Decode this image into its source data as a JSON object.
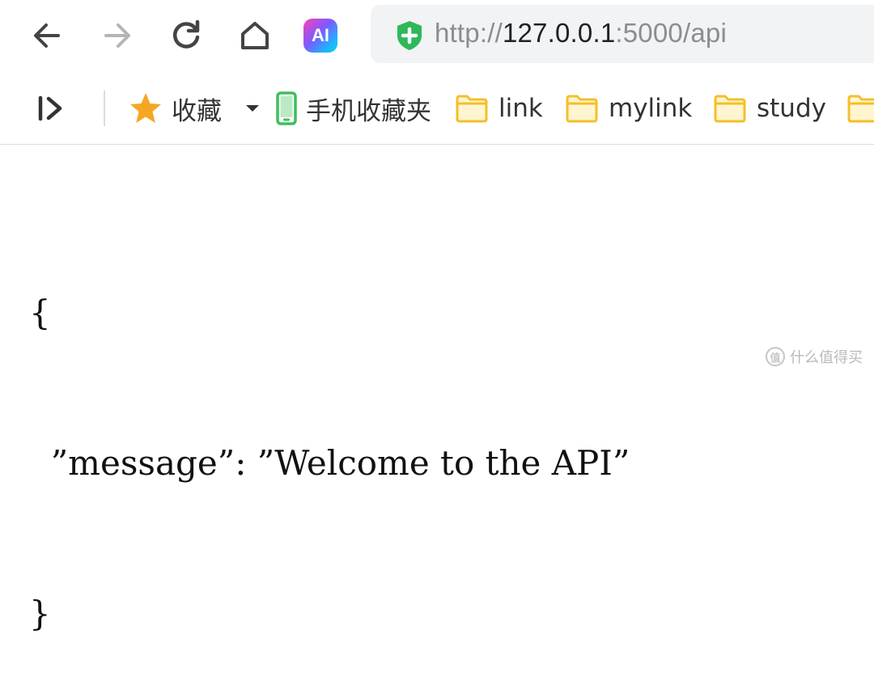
{
  "browser": {
    "ai_button_label": "AI",
    "address": {
      "scheme": "http://",
      "host": "127.0.0.1",
      "rest": ":5000/api"
    }
  },
  "bookmarks": [
    {
      "label": "收藏",
      "icon": "star-icon"
    },
    {
      "label": "手机收藏夹",
      "icon": "phone-icon"
    },
    {
      "label": "link",
      "icon": "folder-icon"
    },
    {
      "label": "mylink",
      "icon": "folder-icon"
    },
    {
      "label": "study",
      "icon": "folder-icon"
    }
  ],
  "json_body": {
    "open_brace": "{",
    "line": "  ”message”: ”Welcome to the API”",
    "close_brace": "}"
  },
  "watermark": {
    "icon_text": "值",
    "text": "什么值得买"
  },
  "colors": {
    "star": "#f5a623",
    "folder": "#f8c94a",
    "shield": "#2fb85a",
    "phone": "#3cbf5d"
  }
}
